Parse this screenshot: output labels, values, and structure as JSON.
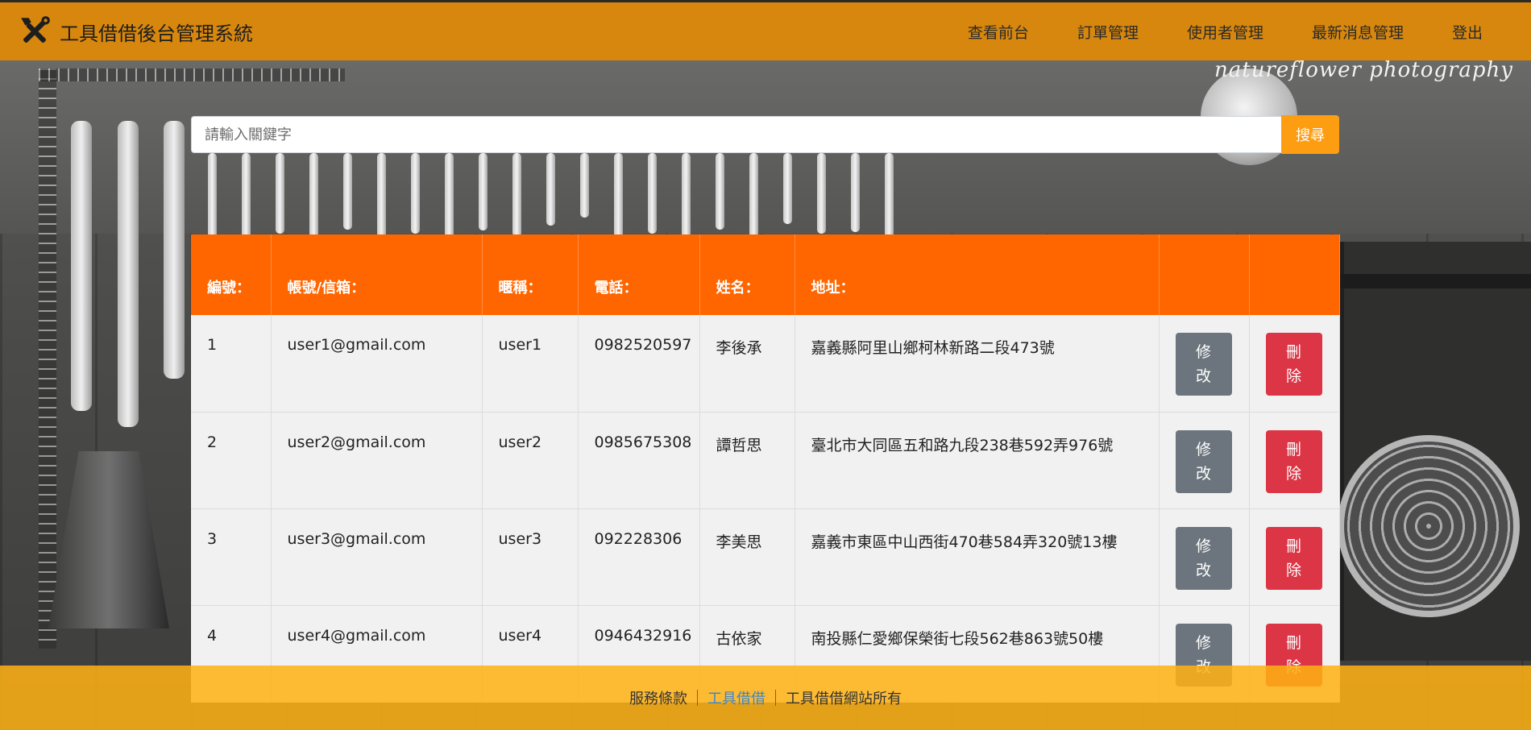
{
  "brand": {
    "title": "工具借借後台管理系統",
    "icon": "tools-icon"
  },
  "nav": {
    "items": [
      {
        "label": "查看前台"
      },
      {
        "label": "訂單管理"
      },
      {
        "label": "使用者管理"
      },
      {
        "label": "最新消息管理"
      },
      {
        "label": "登出"
      }
    ]
  },
  "background": {
    "watermark": "natureflower photography"
  },
  "search": {
    "placeholder": "請輸入關鍵字",
    "value": "",
    "button_label": "搜尋"
  },
  "table": {
    "headers": [
      "編號：",
      "帳號/信箱：",
      "暱稱：",
      "電話：",
      "姓名：",
      "地址：",
      "",
      ""
    ],
    "rows": [
      {
        "id": "1",
        "email": "user1@gmail.com",
        "nickname": "user1",
        "phone": "0982520597",
        "name": "李後承",
        "address": "嘉義縣阿里山鄉柯林新路二段473號",
        "edit_label": "修改",
        "delete_label": "刪除"
      },
      {
        "id": "2",
        "email": "user2@gmail.com",
        "nickname": "user2",
        "phone": "0985675308",
        "name": "譚哲思",
        "address": "臺北市大同區五和路九段238巷592弄976號",
        "edit_label": "修改",
        "delete_label": "刪除"
      },
      {
        "id": "3",
        "email": "user3@gmail.com",
        "nickname": "user3",
        "phone": "092228306",
        "name": "李美思",
        "address": "嘉義市東區中山西街470巷584弄320號13樓",
        "edit_label": "修改",
        "delete_label": "刪除"
      },
      {
        "id": "4",
        "email": "user4@gmail.com",
        "nickname": "user4",
        "phone": "0946432916",
        "name": "古依家",
        "address": "南投縣仁愛鄉保榮街七段562巷863號50樓",
        "edit_label": "修改",
        "delete_label": "刪除"
      }
    ]
  },
  "footer": {
    "terms": "服務條款",
    "site_link": "工具借借",
    "copyright": "工具借借網站所有"
  },
  "colors": {
    "navbar": "#d7870d",
    "table_header": "#ff6600",
    "search_button": "#fd9d12",
    "edit_button": "#6c757d",
    "delete_button": "#dc3545",
    "footer": "#ffb114",
    "footer_link": "#3b86c9"
  }
}
